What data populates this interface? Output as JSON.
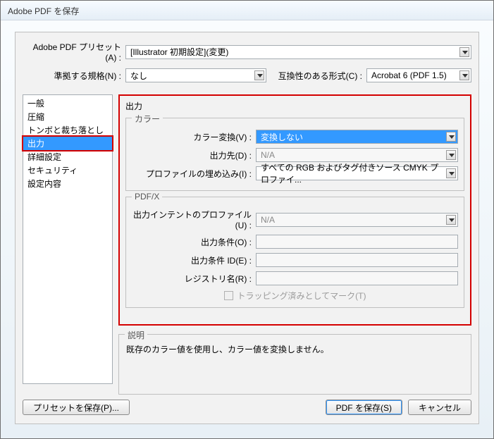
{
  "window": {
    "title": "Adobe PDF を保存"
  },
  "top": {
    "preset_label": "Adobe PDF プリセット(A) :",
    "preset_value": "[Illustrator 初期設定](変更)",
    "standard_label": "準拠する規格(N) :",
    "standard_value": "なし",
    "compat_label": "互換性のある形式(C) :",
    "compat_value": "Acrobat 6 (PDF 1.5)"
  },
  "sidebar": {
    "items": [
      "一般",
      "圧縮",
      "トンボと裁ち落とし",
      "出力",
      "詳細設定",
      "セキュリティ",
      "設定内容"
    ],
    "selected_index": 3
  },
  "panel": {
    "title": "出力",
    "color_group": {
      "legend": "カラー",
      "convert_label": "カラー変換(V) :",
      "convert_value": "変換しない",
      "dest_label": "出力先(D) :",
      "dest_value": "N/A",
      "profile_label": "プロファイルの埋め込み(I) :",
      "profile_value": "すべての RGB およびタグ付きソース CMYK プロファイ..."
    },
    "pdfx_group": {
      "legend": "PDF/X",
      "intent_label": "出力インテントのプロファイル(U) :",
      "intent_value": "N/A",
      "cond_label": "出力条件(O) :",
      "cond_value": "",
      "condid_label": "出力条件 ID(E) :",
      "condid_value": "",
      "registry_label": "レジストリ名(R) :",
      "registry_value": "",
      "trap_label": "トラッピング済みとしてマーク(T)"
    },
    "desc_group": {
      "legend": "説明",
      "text": "既存のカラー値を使用し、カラー値を変換しません。"
    }
  },
  "buttons": {
    "save_preset": "プリセットを保存(P)...",
    "save_pdf": "PDF を保存(S)",
    "cancel": "キャンセル"
  }
}
